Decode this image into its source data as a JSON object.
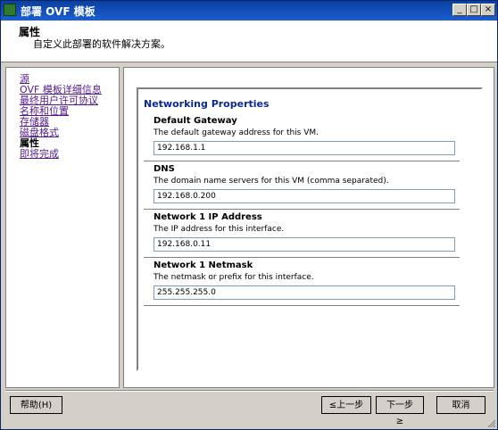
{
  "window": {
    "title": "部署 OVF 模板",
    "controls": {
      "minimize": "_",
      "maximize": "□",
      "close": "×"
    }
  },
  "header": {
    "title": "属性",
    "subtitle": "自定义此部署的软件解决方案。"
  },
  "sidebar": {
    "items": [
      {
        "label": "源",
        "current": false
      },
      {
        "label": "OVF 模板详细信息",
        "current": false
      },
      {
        "label": "最终用户许可协议",
        "current": false
      },
      {
        "label": "名称和位置",
        "current": false
      },
      {
        "label": "存储器",
        "current": false
      },
      {
        "label": "磁盘格式",
        "current": false
      },
      {
        "label": "属性",
        "current": true
      },
      {
        "label": "即将完成",
        "current": false
      }
    ]
  },
  "panel": {
    "title": "Networking Properties",
    "properties": [
      {
        "label": "Default Gateway",
        "description": "The default gateway address for this VM.",
        "value": "192.168.1.1"
      },
      {
        "label": "DNS",
        "description": "The domain name servers for this VM (comma separated).",
        "value": "192.168.0.200"
      },
      {
        "label": "Network 1 IP Address",
        "description": "The IP address for this interface.",
        "value": "192.168.0.11"
      },
      {
        "label": "Network 1 Netmask",
        "description": "The netmask or prefix for this interface.",
        "value": "255.255.255.0"
      }
    ]
  },
  "footer": {
    "help": "帮助(H)",
    "back": "≤上一步",
    "next": "下一步 ≥",
    "cancel": "取消"
  },
  "colors": {
    "titlebar": "#0a3fa0",
    "panel_title": "#0b2a8c",
    "link": "#551a8b"
  }
}
